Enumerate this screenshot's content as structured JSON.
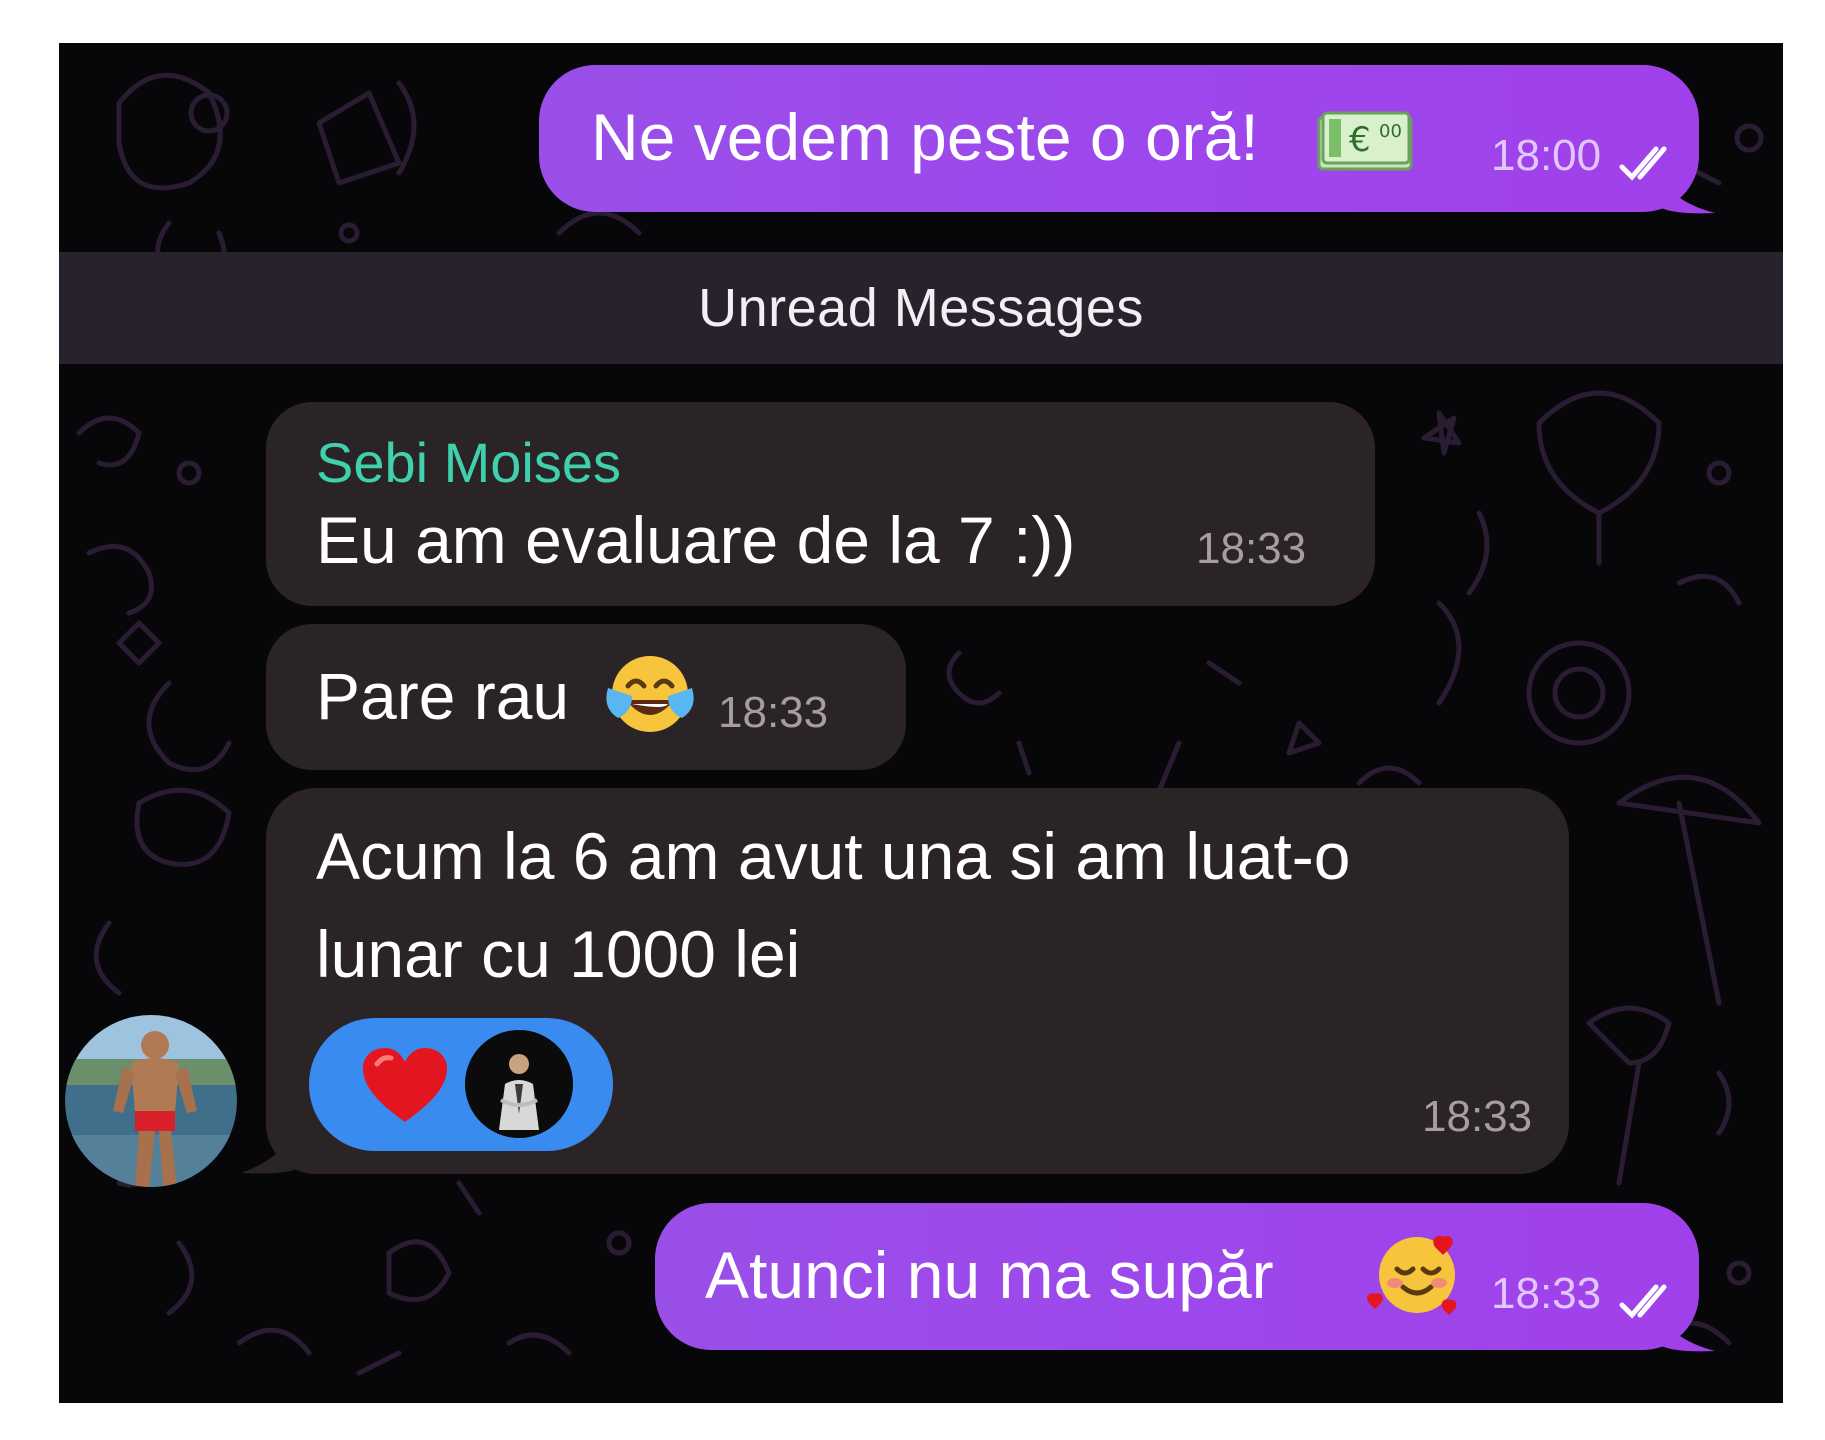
{
  "messages": {
    "out1": {
      "text": "Ne vedem peste o oră!",
      "emoji": "euro-banknote-emoji",
      "time": "18:00"
    },
    "unread_label": "Unread Messages",
    "in_sender": "Sebi Moises",
    "in1": {
      "text": "Eu am evaluare de la 7 :))",
      "time": "18:33"
    },
    "in2": {
      "text": "Pare rau",
      "emoji": "face-with-tears-of-joy-emoji",
      "time": "18:33"
    },
    "in3": {
      "line1": "Acum la 6 am avut una si am luat-o",
      "line2": "lunar cu 1000 lei",
      "time": "18:33",
      "reaction": {
        "emoji": "red-heart-emoji",
        "reactor": "reactor-avatar"
      }
    },
    "out2": {
      "text": "Atunci nu ma supăr",
      "emoji": "smiling-face-with-hearts-emoji",
      "time": "18:33"
    }
  },
  "colors": {
    "outgoing_bubble": "#9d47ec",
    "incoming_bubble": "#2b2426",
    "sender_name": "#3fd1ad",
    "reaction_pill": "#3a8bf0",
    "background": "#070608"
  }
}
